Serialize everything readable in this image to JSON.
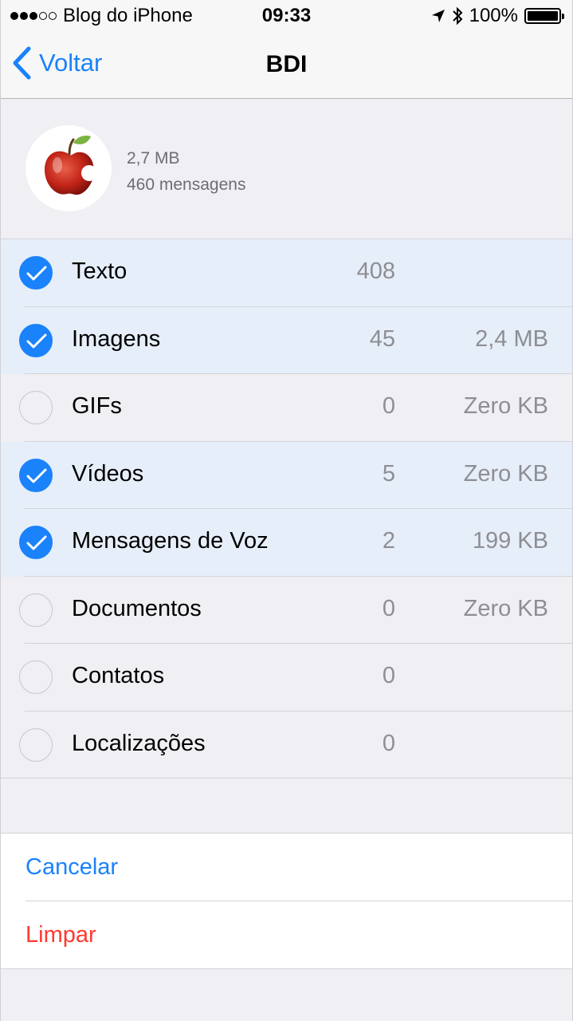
{
  "status_bar": {
    "carrier": "Blog do iPhone",
    "time": "09:33",
    "battery": "100%",
    "battery_level": 1.0,
    "signal_bars_filled": 3,
    "signal_bars_total": 5
  },
  "nav": {
    "back_label": "Voltar",
    "title": "BDI"
  },
  "chat": {
    "size": "2,7 MB",
    "messages": "460 mensagens"
  },
  "categories": [
    {
      "label": "Texto",
      "count": "408",
      "size": "",
      "selected": true
    },
    {
      "label": "Imagens",
      "count": "45",
      "size": "2,4 MB",
      "selected": true
    },
    {
      "label": "GIFs",
      "count": "0",
      "size": "Zero KB",
      "selected": false
    },
    {
      "label": "Vídeos",
      "count": "5",
      "size": "Zero KB",
      "selected": true
    },
    {
      "label": "Mensagens de Voz",
      "count": "2",
      "size": "199 KB",
      "selected": true
    },
    {
      "label": "Documentos",
      "count": "0",
      "size": "Zero KB",
      "selected": false
    },
    {
      "label": "Contatos",
      "count": "0",
      "size": "",
      "selected": false
    },
    {
      "label": "Localizações",
      "count": "0",
      "size": "",
      "selected": false
    }
  ],
  "actions": {
    "cancel_label": "Cancelar",
    "clear_label": "Limpar"
  },
  "colors": {
    "accent": "#1a82fb",
    "destructive": "#ff3b30",
    "selected_row": "#e6eef9"
  }
}
